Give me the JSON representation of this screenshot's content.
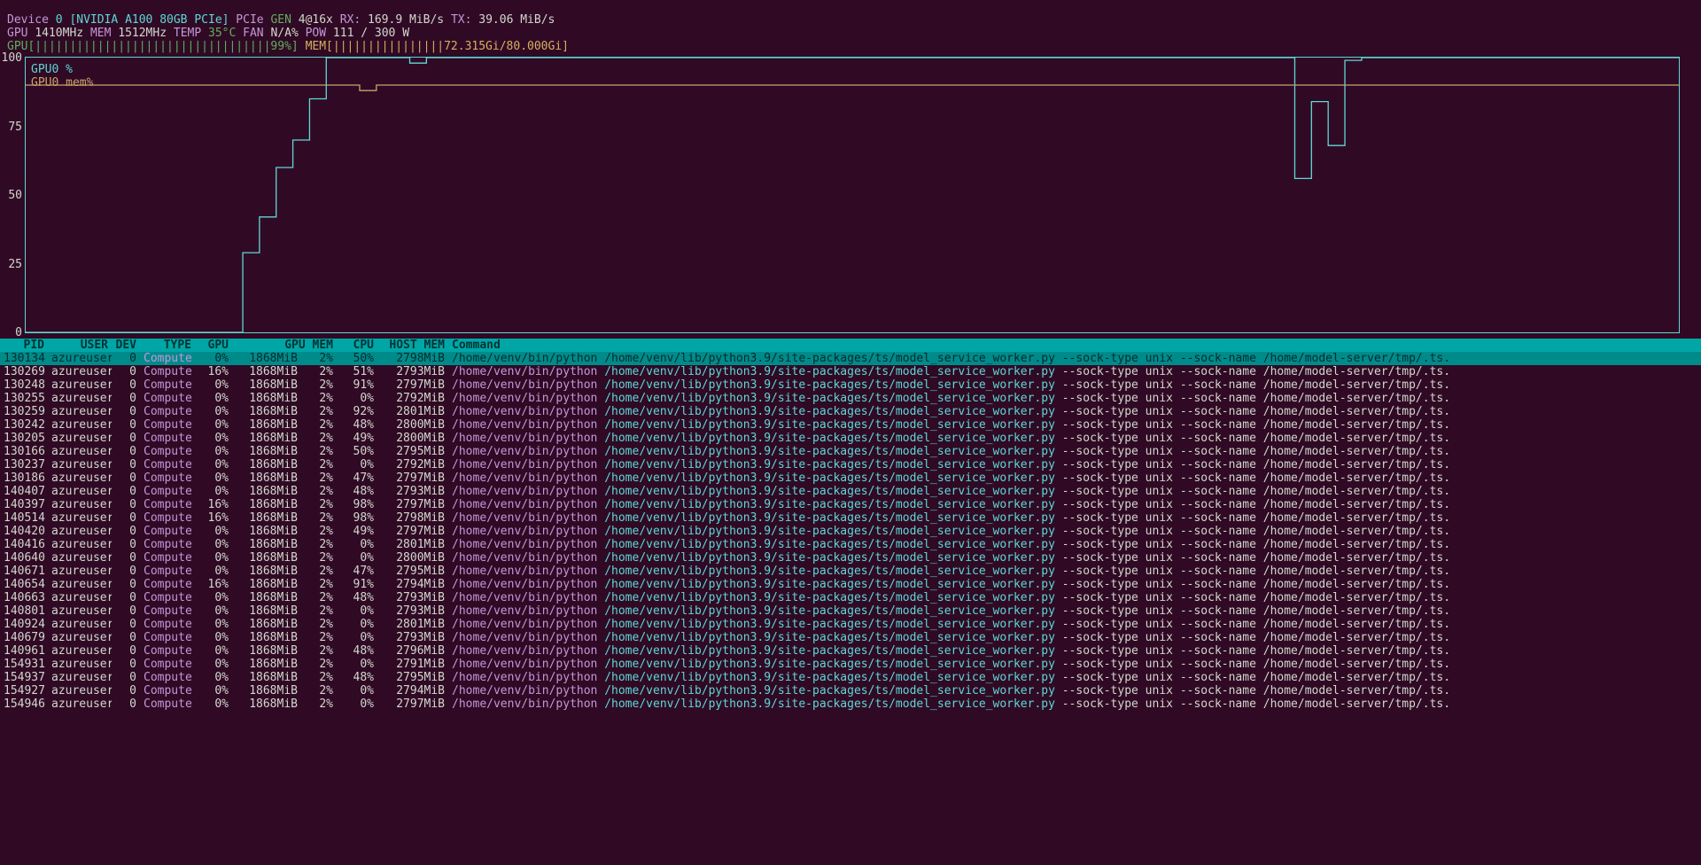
{
  "header": {
    "device_label": "Device",
    "device_id": "0",
    "device_name": "[NVIDIA A100 80GB PCIe]",
    "pcie_label": "PCIe",
    "gen_label": "GEN",
    "gen_val": "4@16x",
    "rx_label": "RX:",
    "rx": "169.9 MiB/s",
    "tx_label": "TX:",
    "tx": "39.06 MiB/s",
    "gpu_label": "GPU",
    "gpu_clock": "1410MHz",
    "mem_label": "MEM",
    "mem_clock": "1512MHz",
    "temp_label": "TEMP",
    "temp": "35°C",
    "fan_label": "FAN",
    "fan": "N/A%",
    "pow_label": "POW",
    "pow": "111 / 300 W",
    "gpu_bar": "GPU[||||||||||||||||||||||||||||||||||99%]",
    "mem_bar": "MEM[||||||||||||||||72.315Gi/80.000Gi]"
  },
  "chart_data": {
    "type": "line",
    "ylabel": "",
    "xlabel": "",
    "ylim": [
      0,
      100
    ],
    "yticks": [
      0,
      25,
      50,
      75,
      100
    ],
    "series": [
      {
        "name": "GPU0 %",
        "color": "#5fd7d7",
        "values": [
          0,
          0,
          0,
          0,
          0,
          0,
          0,
          0,
          0,
          0,
          0,
          0,
          0,
          29,
          42,
          60,
          70,
          85,
          100,
          100,
          100,
          100,
          100,
          98,
          100,
          100,
          100,
          100,
          100,
          100,
          100,
          100,
          100,
          100,
          100,
          100,
          100,
          100,
          100,
          100,
          100,
          100,
          100,
          100,
          100,
          100,
          100,
          100,
          100,
          100,
          100,
          100,
          100,
          100,
          100,
          100,
          100,
          100,
          100,
          100,
          100,
          100,
          100,
          100,
          100,
          100,
          100,
          100,
          100,
          100,
          100,
          100,
          100,
          100,
          100,
          100,
          56,
          84,
          68,
          99,
          100,
          100,
          100,
          100,
          100,
          100,
          100,
          100,
          100,
          100,
          100,
          100,
          100,
          100,
          100,
          100,
          100,
          100,
          100,
          100
        ]
      },
      {
        "name": "GPU0 mem%",
        "color": "#c9a36a",
        "values": [
          90,
          90,
          90,
          90,
          90,
          90,
          90,
          90,
          90,
          90,
          90,
          90,
          90,
          90,
          90,
          90,
          90,
          90,
          90,
          90,
          88,
          90,
          90,
          90,
          90,
          90,
          90,
          90,
          90,
          90,
          90,
          90,
          90,
          90,
          90,
          90,
          90,
          90,
          90,
          90,
          90,
          90,
          90,
          90,
          90,
          90,
          90,
          90,
          90,
          90,
          90,
          90,
          90,
          90,
          90,
          90,
          90,
          90,
          90,
          90,
          90,
          90,
          90,
          90,
          90,
          90,
          90,
          90,
          90,
          90,
          90,
          90,
          90,
          90,
          90,
          90,
          90,
          90,
          90,
          90,
          90,
          90,
          90,
          90,
          90,
          90,
          90,
          90,
          90,
          90,
          90,
          90,
          90,
          90,
          90,
          90,
          90,
          90,
          90,
          90
        ]
      }
    ]
  },
  "columns": [
    "PID",
    "USER",
    "DEV",
    "TYPE",
    "GPU",
    "GPU MEM",
    "CPU",
    "HOST MEM",
    "Command"
  ],
  "cmd": {
    "p1": "/home/venv/bin/python ",
    "p2": "/home/venv/lib/python3.9/site-packages/ts/model_service_worker.py ",
    "p3": "--sock-type unix --sock-name /home/model-server/tmp/.ts."
  },
  "rows": [
    {
      "pid": "130134",
      "user": "azureuser",
      "dev": "0",
      "type": "Compute",
      "gpu": "0%",
      "gpumem": "1868MiB",
      "gpumem_pct": "2%",
      "cpu": "50%",
      "hostmem": "2798MiB",
      "selected": true
    },
    {
      "pid": "130269",
      "user": "azureuser",
      "dev": "0",
      "type": "Compute",
      "gpu": "16%",
      "gpumem": "1868MiB",
      "gpumem_pct": "2%",
      "cpu": "51%",
      "hostmem": "2793MiB"
    },
    {
      "pid": "130248",
      "user": "azureuser",
      "dev": "0",
      "type": "Compute",
      "gpu": "0%",
      "gpumem": "1868MiB",
      "gpumem_pct": "2%",
      "cpu": "91%",
      "hostmem": "2797MiB"
    },
    {
      "pid": "130255",
      "user": "azureuser",
      "dev": "0",
      "type": "Compute",
      "gpu": "0%",
      "gpumem": "1868MiB",
      "gpumem_pct": "2%",
      "cpu": "0%",
      "hostmem": "2792MiB"
    },
    {
      "pid": "130259",
      "user": "azureuser",
      "dev": "0",
      "type": "Compute",
      "gpu": "0%",
      "gpumem": "1868MiB",
      "gpumem_pct": "2%",
      "cpu": "92%",
      "hostmem": "2801MiB"
    },
    {
      "pid": "130242",
      "user": "azureuser",
      "dev": "0",
      "type": "Compute",
      "gpu": "0%",
      "gpumem": "1868MiB",
      "gpumem_pct": "2%",
      "cpu": "48%",
      "hostmem": "2800MiB"
    },
    {
      "pid": "130205",
      "user": "azureuser",
      "dev": "0",
      "type": "Compute",
      "gpu": "0%",
      "gpumem": "1868MiB",
      "gpumem_pct": "2%",
      "cpu": "49%",
      "hostmem": "2800MiB"
    },
    {
      "pid": "130166",
      "user": "azureuser",
      "dev": "0",
      "type": "Compute",
      "gpu": "0%",
      "gpumem": "1868MiB",
      "gpumem_pct": "2%",
      "cpu": "50%",
      "hostmem": "2795MiB"
    },
    {
      "pid": "130237",
      "user": "azureuser",
      "dev": "0",
      "type": "Compute",
      "gpu": "0%",
      "gpumem": "1868MiB",
      "gpumem_pct": "2%",
      "cpu": "0%",
      "hostmem": "2792MiB"
    },
    {
      "pid": "130186",
      "user": "azureuser",
      "dev": "0",
      "type": "Compute",
      "gpu": "0%",
      "gpumem": "1868MiB",
      "gpumem_pct": "2%",
      "cpu": "47%",
      "hostmem": "2797MiB"
    },
    {
      "pid": "140407",
      "user": "azureuser",
      "dev": "0",
      "type": "Compute",
      "gpu": "0%",
      "gpumem": "1868MiB",
      "gpumem_pct": "2%",
      "cpu": "48%",
      "hostmem": "2793MiB"
    },
    {
      "pid": "140397",
      "user": "azureuser",
      "dev": "0",
      "type": "Compute",
      "gpu": "16%",
      "gpumem": "1868MiB",
      "gpumem_pct": "2%",
      "cpu": "98%",
      "hostmem": "2797MiB"
    },
    {
      "pid": "140514",
      "user": "azureuser",
      "dev": "0",
      "type": "Compute",
      "gpu": "16%",
      "gpumem": "1868MiB",
      "gpumem_pct": "2%",
      "cpu": "98%",
      "hostmem": "2798MiB"
    },
    {
      "pid": "140420",
      "user": "azureuser",
      "dev": "0",
      "type": "Compute",
      "gpu": "0%",
      "gpumem": "1868MiB",
      "gpumem_pct": "2%",
      "cpu": "49%",
      "hostmem": "2797MiB"
    },
    {
      "pid": "140416",
      "user": "azureuser",
      "dev": "0",
      "type": "Compute",
      "gpu": "0%",
      "gpumem": "1868MiB",
      "gpumem_pct": "2%",
      "cpu": "0%",
      "hostmem": "2801MiB"
    },
    {
      "pid": "140640",
      "user": "azureuser",
      "dev": "0",
      "type": "Compute",
      "gpu": "0%",
      "gpumem": "1868MiB",
      "gpumem_pct": "2%",
      "cpu": "0%",
      "hostmem": "2800MiB"
    },
    {
      "pid": "140671",
      "user": "azureuser",
      "dev": "0",
      "type": "Compute",
      "gpu": "0%",
      "gpumem": "1868MiB",
      "gpumem_pct": "2%",
      "cpu": "47%",
      "hostmem": "2795MiB"
    },
    {
      "pid": "140654",
      "user": "azureuser",
      "dev": "0",
      "type": "Compute",
      "gpu": "16%",
      "gpumem": "1868MiB",
      "gpumem_pct": "2%",
      "cpu": "91%",
      "hostmem": "2794MiB"
    },
    {
      "pid": "140663",
      "user": "azureuser",
      "dev": "0",
      "type": "Compute",
      "gpu": "0%",
      "gpumem": "1868MiB",
      "gpumem_pct": "2%",
      "cpu": "48%",
      "hostmem": "2793MiB"
    },
    {
      "pid": "140801",
      "user": "azureuser",
      "dev": "0",
      "type": "Compute",
      "gpu": "0%",
      "gpumem": "1868MiB",
      "gpumem_pct": "2%",
      "cpu": "0%",
      "hostmem": "2793MiB"
    },
    {
      "pid": "140924",
      "user": "azureuser",
      "dev": "0",
      "type": "Compute",
      "gpu": "0%",
      "gpumem": "1868MiB",
      "gpumem_pct": "2%",
      "cpu": "0%",
      "hostmem": "2801MiB"
    },
    {
      "pid": "140679",
      "user": "azureuser",
      "dev": "0",
      "type": "Compute",
      "gpu": "0%",
      "gpumem": "1868MiB",
      "gpumem_pct": "2%",
      "cpu": "0%",
      "hostmem": "2793MiB"
    },
    {
      "pid": "140961",
      "user": "azureuser",
      "dev": "0",
      "type": "Compute",
      "gpu": "0%",
      "gpumem": "1868MiB",
      "gpumem_pct": "2%",
      "cpu": "48%",
      "hostmem": "2796MiB"
    },
    {
      "pid": "154931",
      "user": "azureuser",
      "dev": "0",
      "type": "Compute",
      "gpu": "0%",
      "gpumem": "1868MiB",
      "gpumem_pct": "2%",
      "cpu": "0%",
      "hostmem": "2791MiB"
    },
    {
      "pid": "154937",
      "user": "azureuser",
      "dev": "0",
      "type": "Compute",
      "gpu": "0%",
      "gpumem": "1868MiB",
      "gpumem_pct": "2%",
      "cpu": "48%",
      "hostmem": "2795MiB"
    },
    {
      "pid": "154927",
      "user": "azureuser",
      "dev": "0",
      "type": "Compute",
      "gpu": "0%",
      "gpumem": "1868MiB",
      "gpumem_pct": "2%",
      "cpu": "0%",
      "hostmem": "2794MiB"
    },
    {
      "pid": "154946",
      "user": "azureuser",
      "dev": "0",
      "type": "Compute",
      "gpu": "0%",
      "gpumem": "1868MiB",
      "gpumem_pct": "2%",
      "cpu": "0%",
      "hostmem": "2797MiB"
    }
  ]
}
